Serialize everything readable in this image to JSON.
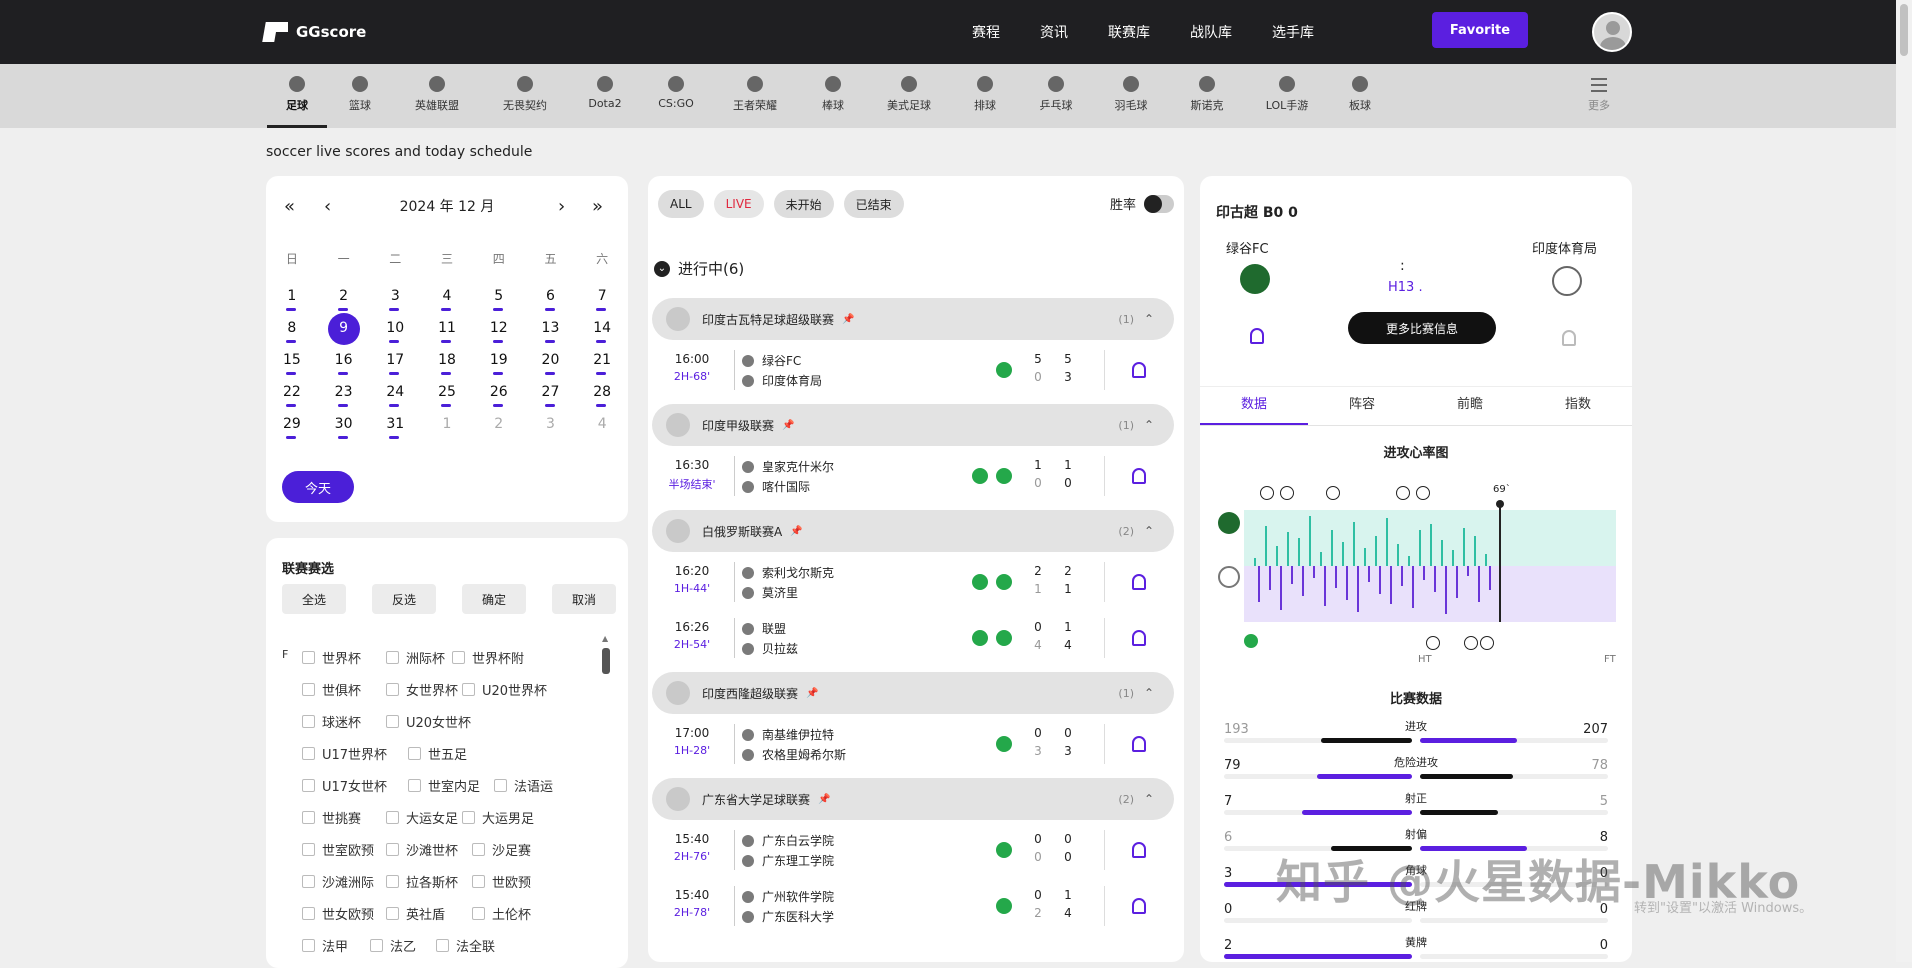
{
  "brand": {
    "name": "GGscore"
  },
  "topnav": [
    "赛程",
    "资讯",
    "联赛库",
    "战队库",
    "选手库"
  ],
  "favorite_label": "Favorite",
  "sports": [
    "足球",
    "篮球",
    "英雄联盟",
    "无畏契约",
    "Dota2",
    "CS:GO",
    "王者荣耀",
    "棒球",
    "美式足球",
    "排球",
    "乒乓球",
    "羽毛球",
    "斯诺克",
    "LOL手游",
    "板球"
  ],
  "more_label": "更多",
  "page_subtitle": "soccer live scores and today schedule",
  "calendar": {
    "month_label": "2024 年 12 月",
    "weekdays": [
      "日",
      "一",
      "二",
      "三",
      "四",
      "五",
      "六"
    ],
    "rows": [
      [
        "1",
        "2",
        "3",
        "4",
        "5",
        "6",
        "7"
      ],
      [
        "8",
        "9",
        "10",
        "11",
        "12",
        "13",
        "14"
      ],
      [
        "15",
        "16",
        "17",
        "18",
        "19",
        "20",
        "21"
      ],
      [
        "22",
        "23",
        "24",
        "25",
        "26",
        "27",
        "28"
      ],
      [
        "29",
        "30",
        "31",
        "1",
        "2",
        "3",
        "4"
      ]
    ],
    "today_label": "今天"
  },
  "league_filter": {
    "title": "联赛赛选",
    "buttons": [
      "全选",
      "反选",
      "确定",
      "取消"
    ],
    "letter": "F",
    "items": [
      [
        "世界杯",
        "洲际杯",
        "世界杯附"
      ],
      [
        "世俱杯",
        "女世界杯",
        "U20世界杯"
      ],
      [
        "球迷杯",
        "U20女世杯"
      ],
      [
        "U17世界杯",
        "世五足"
      ],
      [
        "U17女世杯",
        "世室内足",
        "法语运"
      ],
      [
        "世挑赛",
        "大运女足",
        "大运男足"
      ],
      [
        "世室欧预",
        "沙滩世杯",
        "沙足赛"
      ],
      [
        "沙滩洲际",
        "拉各斯杯",
        "世欧预"
      ],
      [
        "世女欧预",
        "英社盾",
        "土伦杯"
      ],
      [
        "法甲",
        "法乙",
        "法全联"
      ]
    ]
  },
  "filters": [
    "ALL",
    "LIVE",
    "未开始",
    "已结束"
  ],
  "winrate_label": "胜率",
  "ongoing_label": "进行中(6)",
  "leagues": [
    {
      "name": "印度古瓦特足球超级联赛",
      "count": "(1)",
      "matches": [
        {
          "time": "16:00",
          "minute": "2H-68'",
          "home": "绿谷FC",
          "away": "印度体育局",
          "h1": "5",
          "h2": "5",
          "a1": "0",
          "a2": "3",
          "play": false
        }
      ]
    },
    {
      "name": "印度甲级联赛",
      "count": "(1)",
      "matches": [
        {
          "time": "16:30",
          "minute": "半场结束'",
          "home": "皇家克什米尔",
          "away": "喀什国际",
          "h1": "1",
          "h2": "1",
          "a1": "0",
          "a2": "0",
          "play": true
        }
      ]
    },
    {
      "name": "白俄罗斯联赛A",
      "count": "(2)",
      "matches": [
        {
          "time": "16:20",
          "minute": "1H-44'",
          "home": "索利戈尔斯克",
          "away": "莫济里",
          "h1": "2",
          "h2": "2",
          "a1": "1",
          "a2": "1",
          "play": true
        },
        {
          "time": "16:26",
          "minute": "2H-54'",
          "home": "联盟",
          "away": "贝拉兹",
          "h1": "0",
          "h2": "1",
          "a1": "4",
          "a2": "4",
          "play": true
        }
      ]
    },
    {
      "name": "印度西隆超级联赛",
      "count": "(1)",
      "matches": [
        {
          "time": "17:00",
          "minute": "1H-28'",
          "home": "南基维伊拉特",
          "away": "农格里姆希尔斯",
          "h1": "0",
          "h2": "0",
          "a1": "3",
          "a2": "3",
          "play": false
        }
      ]
    },
    {
      "name": "广东省大学足球联赛",
      "count": "(2)",
      "matches": [
        {
          "time": "15:40",
          "minute": "2H-76'",
          "home": "广东白云学院",
          "away": "广东理工学院",
          "h1": "0",
          "h2": "0",
          "a1": "0",
          "a2": "0",
          "play": false
        },
        {
          "time": "15:40",
          "minute": "2H-78'",
          "home": "广州软件学院",
          "away": "广东医科大学",
          "h1": "0",
          "h2": "1",
          "a1": "2",
          "a2": "4",
          "play": false
        }
      ]
    }
  ],
  "detail": {
    "title": "印古超 B0 0",
    "home": "绿谷FC",
    "away": "印度体育局",
    "colon": ":",
    "status": "H13 .",
    "more_label": "更多比赛信息",
    "tabs": [
      "数据",
      "阵容",
      "前瞻",
      "指数"
    ],
    "heart_title": "进攻心率图",
    "minute_marker": "69`",
    "ht": "HT",
    "ft": "FT",
    "stats_title": "比赛数据",
    "stats": [
      {
        "name": "进攻",
        "home": "193",
        "away": "207"
      },
      {
        "name": "危险进攻",
        "home": "79",
        "away": "78"
      },
      {
        "name": "射正",
        "home": "7",
        "away": "5"
      },
      {
        "name": "射偏",
        "home": "6",
        "away": "8"
      },
      {
        "name": "角球",
        "home": "3",
        "away": "0"
      },
      {
        "name": "红牌",
        "home": "0",
        "away": "0"
      },
      {
        "name": "黄牌",
        "home": "2",
        "away": "0"
      }
    ]
  },
  "watermark": {
    "main": "知乎 @火星数据-Mikko",
    "sub": "转到\"设置\"以激活 Windows。"
  },
  "colors": {
    "accent": "#5b1fe0",
    "topbar": "#1f1f22",
    "live": "#e0283e",
    "field_icon": "#24a84a"
  }
}
